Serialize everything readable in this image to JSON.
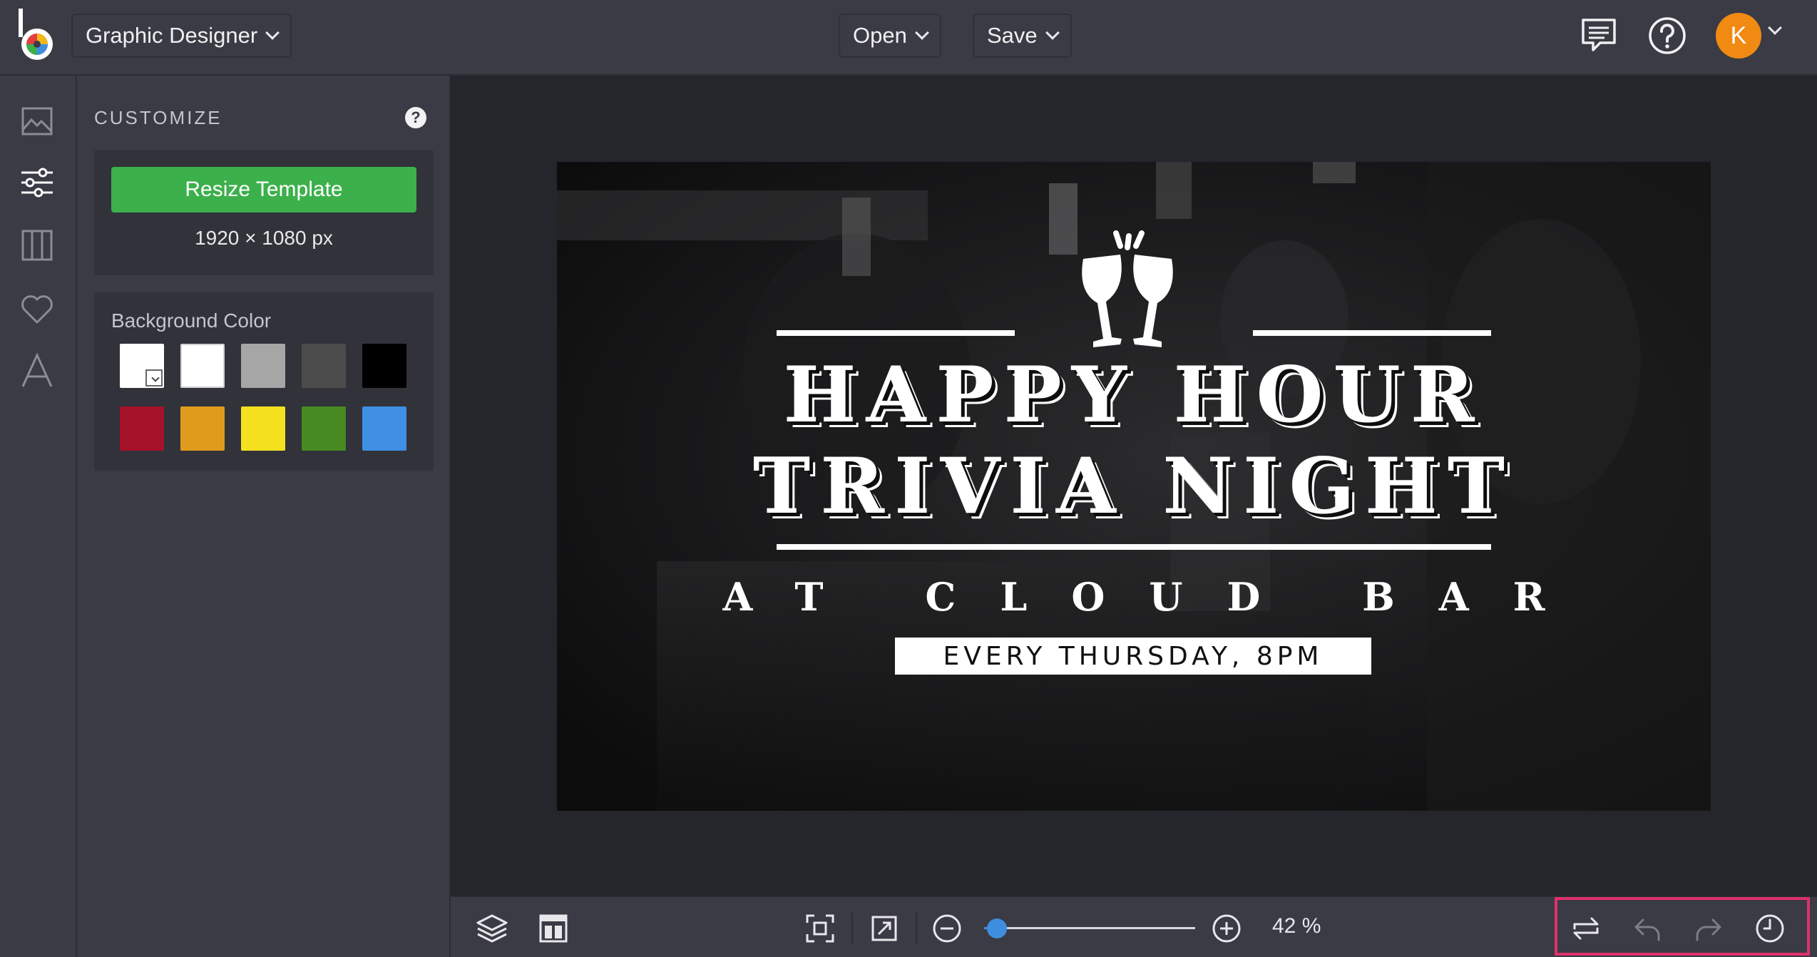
{
  "header": {
    "app_switch_label": "Graphic Designer",
    "open_label": "Open",
    "save_label": "Save",
    "avatar_initial": "K",
    "icons": [
      "chat-icon",
      "help-circle-icon",
      "chevron-down-icon"
    ]
  },
  "rail": {
    "items": [
      "image-icon",
      "sliders-icon",
      "columns-icon",
      "heart-icon",
      "text-icon"
    ],
    "active": "sliders-icon"
  },
  "customize": {
    "title": "CUSTOMIZE",
    "help_icon": "?",
    "resize_label": "Resize Template",
    "dimensions": "1920 × 1080 px",
    "background_label": "Background Color",
    "swatches_row1": [
      "#ffffff",
      "#ffffff",
      "#a6a6a6",
      "#4c4c4c",
      "#000000"
    ],
    "swatches_row2": [
      "#a5122a",
      "#e09b1c",
      "#f4e01e",
      "#478a22",
      "#3f8fe4"
    ]
  },
  "artboard": {
    "line1": "HAPPY HOUR",
    "line2": "TRIVIA NIGHT",
    "line3": "AT CLOUD BAR",
    "date": "EVERY THURSDAY, 8PM"
  },
  "bottombar": {
    "left_icons": [
      "layers-icon",
      "layout-icon"
    ],
    "view_icons": [
      "fit-to-screen-icon",
      "expand-icon"
    ],
    "zoom_out": "minus-circle-icon",
    "zoom_in": "plus-circle-icon",
    "zoom_level": 0.42,
    "zoom_label": "42 %",
    "right_icons": [
      "swap-icon",
      "undo-icon",
      "redo-icon",
      "history-icon"
    ]
  },
  "colors": {
    "accent_green": "#3cb04b",
    "accent_blue": "#3e8ee0",
    "avatar_orange": "#f08a12",
    "highlight_pink": "#e0306a"
  }
}
